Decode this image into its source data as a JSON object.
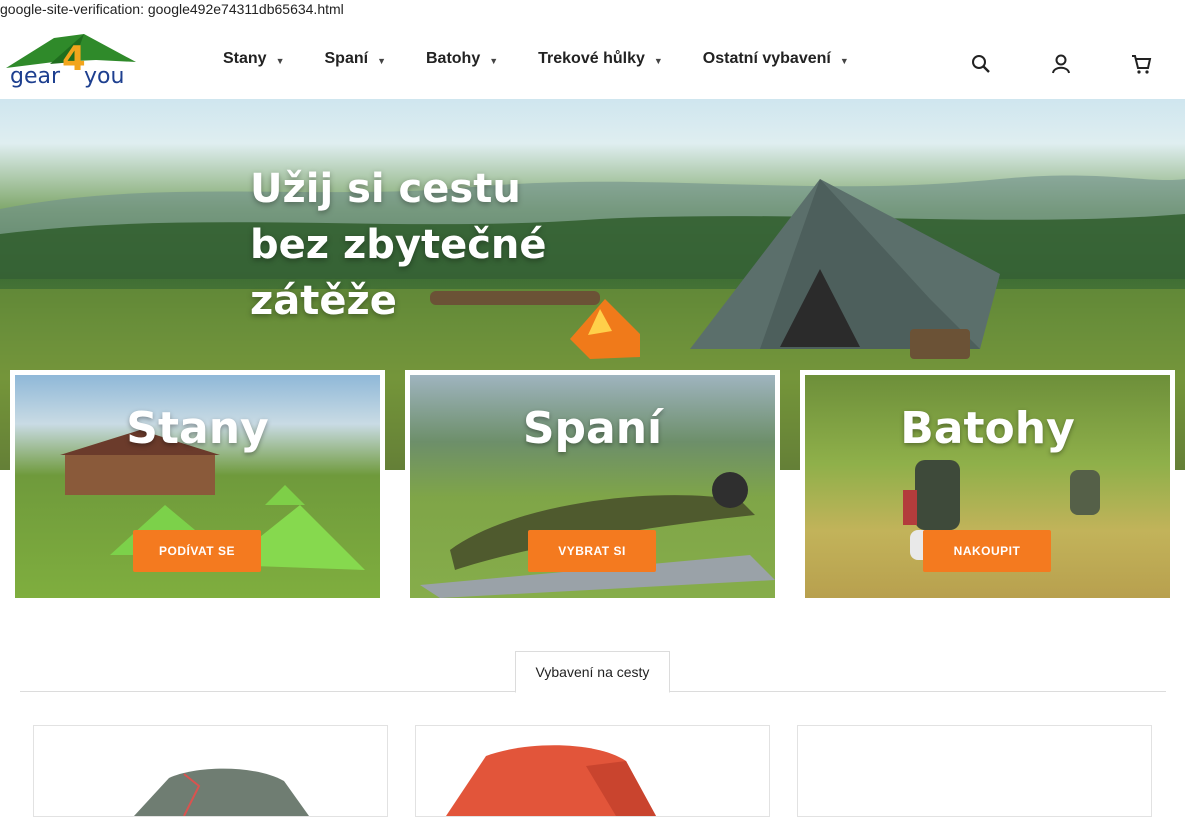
{
  "verification_text": "google-site-verification: google492e74311db65634.html",
  "logo": {
    "text_left": "gear",
    "number": "4",
    "text_right": "you"
  },
  "nav": [
    {
      "label": "Stany"
    },
    {
      "label": "Spaní"
    },
    {
      "label": "Batohy"
    },
    {
      "label": "Trekové hůlky"
    },
    {
      "label": "Ostatní vybavení"
    }
  ],
  "header_icons": [
    "search-icon",
    "user-icon",
    "cart-icon"
  ],
  "hero": {
    "line1": "Užij si cestu",
    "line2": "bez zbytečné",
    "line3": "zátěže"
  },
  "cards": [
    {
      "title": "Stany",
      "button": "PODÍVAT SE"
    },
    {
      "title": "Spaní",
      "button": "VYBRAT SI"
    },
    {
      "title": "Batohy",
      "button": "NAKOUPIT"
    }
  ],
  "tab": {
    "label": "Vybavení na cesty"
  },
  "colors": {
    "accent_orange": "#f47a1f",
    "logo_green": "#2f8a2a",
    "logo_blue": "#1d3f8f",
    "logo_orange": "#f2a51c"
  }
}
